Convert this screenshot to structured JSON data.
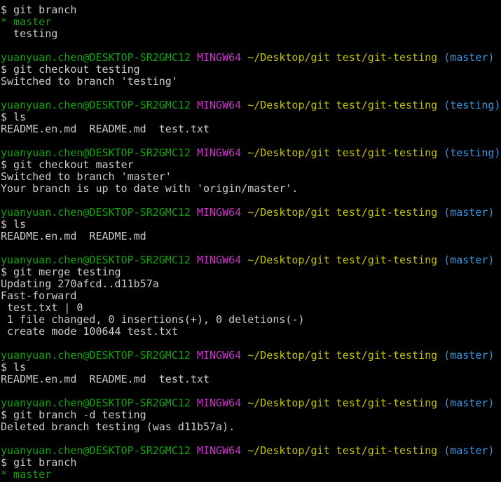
{
  "terminal": {
    "colors": {
      "background": "#000000",
      "default_text": "#cccccc",
      "user_host": "#13a10e",
      "mingw": "#c239c0",
      "path": "#c1c100",
      "branch": "#3a96dd"
    },
    "lines": [
      {
        "segments": [
          {
            "text": "$ git branch",
            "color": "default_text"
          }
        ]
      },
      {
        "segments": [
          {
            "text": "* master",
            "color": "user_host"
          }
        ]
      },
      {
        "segments": [
          {
            "text": "  testing",
            "color": "default_text"
          }
        ]
      },
      {
        "segments": []
      },
      {
        "segments": [
          {
            "text": "yuanyuan.chen@DESKTOP-SR2GMC12",
            "color": "user_host"
          },
          {
            "text": " ",
            "color": "default_text"
          },
          {
            "text": "MINGW64",
            "color": "mingw"
          },
          {
            "text": " ",
            "color": "default_text"
          },
          {
            "text": "~/Desktop/git test/git-testing",
            "color": "path"
          },
          {
            "text": " ",
            "color": "default_text"
          },
          {
            "text": "(master)",
            "color": "branch"
          }
        ]
      },
      {
        "segments": [
          {
            "text": "$ git checkout testing",
            "color": "default_text"
          }
        ]
      },
      {
        "segments": [
          {
            "text": "Switched to branch 'testing'",
            "color": "default_text"
          }
        ]
      },
      {
        "segments": []
      },
      {
        "segments": [
          {
            "text": "yuanyuan.chen@DESKTOP-SR2GMC12",
            "color": "user_host"
          },
          {
            "text": " ",
            "color": "default_text"
          },
          {
            "text": "MINGW64",
            "color": "mingw"
          },
          {
            "text": " ",
            "color": "default_text"
          },
          {
            "text": "~/Desktop/git test/git-testing",
            "color": "path"
          },
          {
            "text": " ",
            "color": "default_text"
          },
          {
            "text": "(testing)",
            "color": "branch"
          }
        ]
      },
      {
        "segments": [
          {
            "text": "$ ls",
            "color": "default_text"
          }
        ]
      },
      {
        "segments": [
          {
            "text": "README.en.md  README.md  test.txt",
            "color": "default_text"
          }
        ]
      },
      {
        "segments": []
      },
      {
        "segments": [
          {
            "text": "yuanyuan.chen@DESKTOP-SR2GMC12",
            "color": "user_host"
          },
          {
            "text": " ",
            "color": "default_text"
          },
          {
            "text": "MINGW64",
            "color": "mingw"
          },
          {
            "text": " ",
            "color": "default_text"
          },
          {
            "text": "~/Desktop/git test/git-testing",
            "color": "path"
          },
          {
            "text": " ",
            "color": "default_text"
          },
          {
            "text": "(testing)",
            "color": "branch"
          }
        ]
      },
      {
        "segments": [
          {
            "text": "$ git checkout master",
            "color": "default_text"
          }
        ]
      },
      {
        "segments": [
          {
            "text": "Switched to branch 'master'",
            "color": "default_text"
          }
        ]
      },
      {
        "segments": [
          {
            "text": "Your branch is up to date with 'origin/master'.",
            "color": "default_text"
          }
        ]
      },
      {
        "segments": []
      },
      {
        "segments": [
          {
            "text": "yuanyuan.chen@DESKTOP-SR2GMC12",
            "color": "user_host"
          },
          {
            "text": " ",
            "color": "default_text"
          },
          {
            "text": "MINGW64",
            "color": "mingw"
          },
          {
            "text": " ",
            "color": "default_text"
          },
          {
            "text": "~/Desktop/git test/git-testing",
            "color": "path"
          },
          {
            "text": " ",
            "color": "default_text"
          },
          {
            "text": "(master)",
            "color": "branch"
          }
        ]
      },
      {
        "segments": [
          {
            "text": "$ ls",
            "color": "default_text"
          }
        ]
      },
      {
        "segments": [
          {
            "text": "README.en.md  README.md",
            "color": "default_text"
          }
        ]
      },
      {
        "segments": []
      },
      {
        "segments": [
          {
            "text": "yuanyuan.chen@DESKTOP-SR2GMC12",
            "color": "user_host"
          },
          {
            "text": " ",
            "color": "default_text"
          },
          {
            "text": "MINGW64",
            "color": "mingw"
          },
          {
            "text": " ",
            "color": "default_text"
          },
          {
            "text": "~/Desktop/git test/git-testing",
            "color": "path"
          },
          {
            "text": " ",
            "color": "default_text"
          },
          {
            "text": "(master)",
            "color": "branch"
          }
        ]
      },
      {
        "segments": [
          {
            "text": "$ git merge testing",
            "color": "default_text"
          }
        ]
      },
      {
        "segments": [
          {
            "text": "Updating 270afcd..d11b57a",
            "color": "default_text"
          }
        ]
      },
      {
        "segments": [
          {
            "text": "Fast-forward",
            "color": "default_text"
          }
        ]
      },
      {
        "segments": [
          {
            "text": " test.txt | 0",
            "color": "default_text"
          }
        ]
      },
      {
        "segments": [
          {
            "text": " 1 file changed, 0 insertions(+), 0 deletions(-)",
            "color": "default_text"
          }
        ]
      },
      {
        "segments": [
          {
            "text": " create mode 100644 test.txt",
            "color": "default_text"
          }
        ]
      },
      {
        "segments": []
      },
      {
        "segments": [
          {
            "text": "yuanyuan.chen@DESKTOP-SR2GMC12",
            "color": "user_host"
          },
          {
            "text": " ",
            "color": "default_text"
          },
          {
            "text": "MINGW64",
            "color": "mingw"
          },
          {
            "text": " ",
            "color": "default_text"
          },
          {
            "text": "~/Desktop/git test/git-testing",
            "color": "path"
          },
          {
            "text": " ",
            "color": "default_text"
          },
          {
            "text": "(master)",
            "color": "branch"
          }
        ]
      },
      {
        "segments": [
          {
            "text": "$ ls",
            "color": "default_text"
          }
        ]
      },
      {
        "segments": [
          {
            "text": "README.en.md  README.md  test.txt",
            "color": "default_text"
          }
        ]
      },
      {
        "segments": []
      },
      {
        "segments": [
          {
            "text": "yuanyuan.chen@DESKTOP-SR2GMC12",
            "color": "user_host"
          },
          {
            "text": " ",
            "color": "default_text"
          },
          {
            "text": "MINGW64",
            "color": "mingw"
          },
          {
            "text": " ",
            "color": "default_text"
          },
          {
            "text": "~/Desktop/git test/git-testing",
            "color": "path"
          },
          {
            "text": " ",
            "color": "default_text"
          },
          {
            "text": "(master)",
            "color": "branch"
          }
        ]
      },
      {
        "segments": [
          {
            "text": "$ git branch -d testing",
            "color": "default_text"
          }
        ]
      },
      {
        "segments": [
          {
            "text": "Deleted branch testing (was d11b57a).",
            "color": "default_text"
          }
        ]
      },
      {
        "segments": []
      },
      {
        "segments": [
          {
            "text": "yuanyuan.chen@DESKTOP-SR2GMC12",
            "color": "user_host"
          },
          {
            "text": " ",
            "color": "default_text"
          },
          {
            "text": "MINGW64",
            "color": "mingw"
          },
          {
            "text": " ",
            "color": "default_text"
          },
          {
            "text": "~/Desktop/git test/git-testing",
            "color": "path"
          },
          {
            "text": " ",
            "color": "default_text"
          },
          {
            "text": "(master)",
            "color": "branch"
          }
        ]
      },
      {
        "segments": [
          {
            "text": "$ git branch",
            "color": "default_text"
          }
        ]
      },
      {
        "segments": [
          {
            "text": "* master",
            "color": "user_host"
          }
        ]
      }
    ]
  }
}
